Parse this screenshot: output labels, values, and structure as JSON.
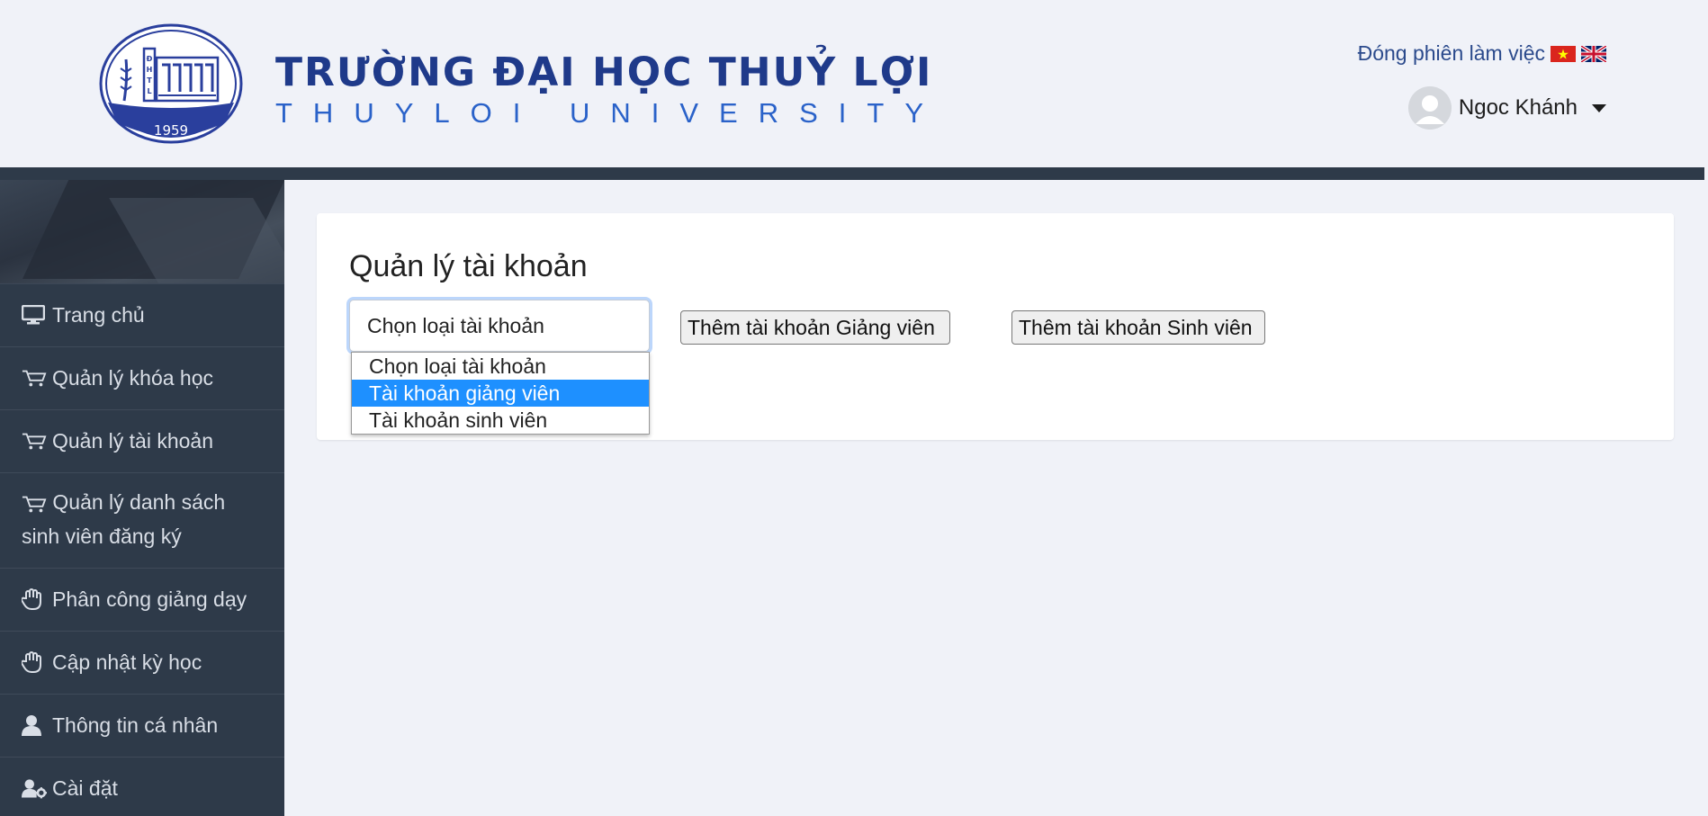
{
  "header": {
    "university_name_vi": "TRƯỜNG ĐẠI HỌC THUỶ LỢI",
    "university_name_en": "THUYLOI UNIVERSITY",
    "logo_year": "1959",
    "logo_abbrev": "ĐHTL",
    "logout_label": "Đóng phiên làm việc",
    "flags": [
      "vietnam-flag-icon",
      "uk-flag-icon"
    ],
    "user_name": "Ngoc Khánh"
  },
  "sidebar": {
    "items": [
      {
        "label": "Trang chủ",
        "icon": "monitor-icon"
      },
      {
        "label": "Quản lý khóa học",
        "icon": "cart-icon"
      },
      {
        "label": "Quản lý tài khoản",
        "icon": "cart-icon"
      },
      {
        "label": "Quản lý danh sách sinh viên đăng ký",
        "icon": "cart-icon"
      },
      {
        "label": "Phân công giảng dạy",
        "icon": "hand-icon"
      },
      {
        "label": "Cập nhật kỳ học",
        "icon": "hand-icon"
      },
      {
        "label": "Thông tin cá nhân",
        "icon": "user-icon"
      },
      {
        "label": "Cài đặt",
        "icon": "user-gear-icon"
      }
    ]
  },
  "main": {
    "title": "Quản lý tài khoản",
    "select": {
      "value": "Chọn loại tài khoản",
      "options": [
        "Chọn loại tài khoản",
        "Tài khoản giảng viên",
        "Tài khoản sinh viên"
      ],
      "highlighted_index": 1
    },
    "buttons": {
      "add_lecturer": "Thêm tài khoản Giảng viên",
      "add_student": "Thêm tài khoản Sinh viên"
    }
  },
  "colors": {
    "sidebar_bg": "#2e3a49",
    "brand_blue": "#1f3a8a",
    "highlight": "#1e90ff",
    "page_bg": "#f0f2f8"
  }
}
